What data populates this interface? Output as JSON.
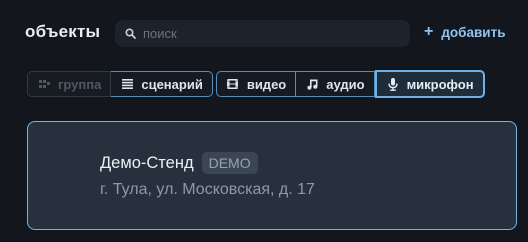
{
  "header": {
    "title": "объекты",
    "search_placeholder": "поиск",
    "add_label": "добавить",
    "add_symbol": "+"
  },
  "tabs": [
    {
      "label": "группа",
      "icon": "group-icon",
      "state": "disabled"
    },
    {
      "label": "сценарий",
      "icon": "list-icon",
      "state": "normal"
    },
    {
      "label": "видео",
      "icon": "film-icon",
      "state": "normal"
    },
    {
      "label": "аудио",
      "icon": "music-note-icon",
      "state": "normal"
    },
    {
      "label": "микрофон",
      "icon": "microphone-icon",
      "state": "active"
    }
  ],
  "card": {
    "name": "Демо-Стенд",
    "badge": "DEMO",
    "address": "г. Тула, ул. Московская, д. 17"
  },
  "colors": {
    "background": "#13171d",
    "accent": "#8fc3f2",
    "card_background": "#27313e",
    "card_border": "#79b3d9",
    "tab_border": "#5a8fb8"
  }
}
